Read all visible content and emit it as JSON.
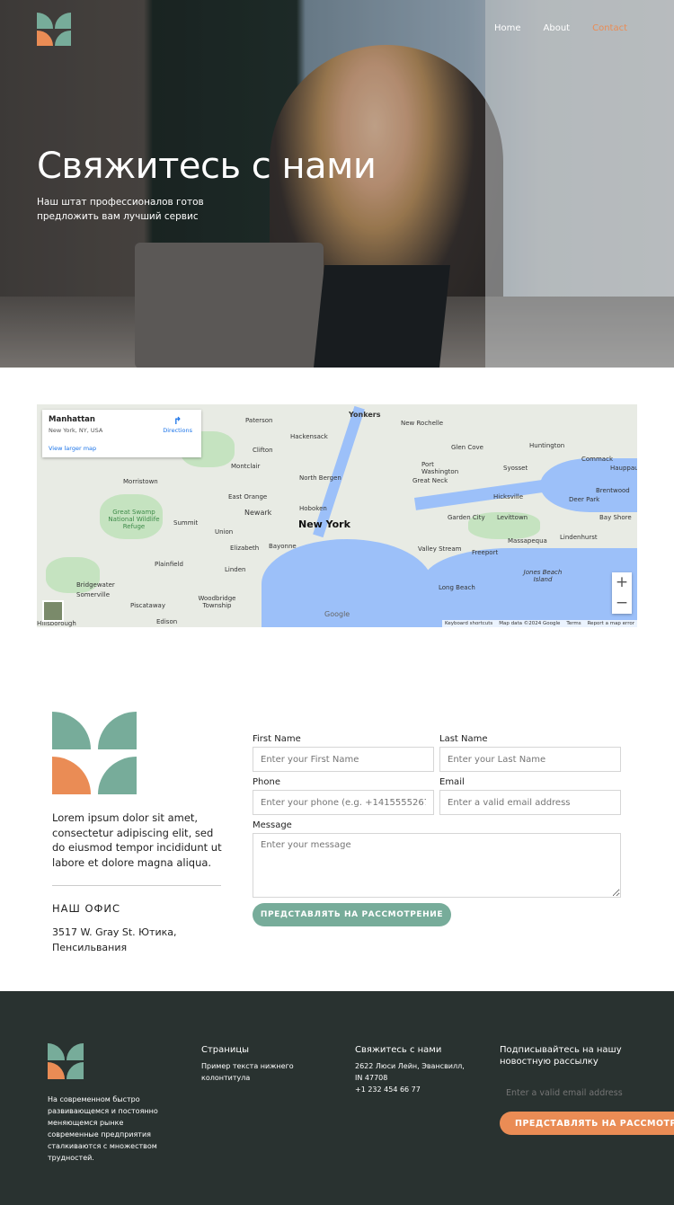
{
  "nav": {
    "items": [
      {
        "label": "Home"
      },
      {
        "label": "About"
      },
      {
        "label": "Contact",
        "active": true
      }
    ]
  },
  "hero": {
    "title": "Свяжитесь с нами",
    "subtitle": "Наш штат профессионалов готов предложить вам лучший сервис"
  },
  "map": {
    "place_title": "Manhattan",
    "place_address": "New York, NY, USA",
    "directions_label": "Directions",
    "view_larger": "View larger map",
    "zoom_in": "+",
    "zoom_out": "−",
    "google": "Google",
    "attribution": [
      "Keyboard shortcuts",
      "Map data ©2024 Google",
      "Terms",
      "Report a map error"
    ],
    "labels": [
      "Yonkers",
      "Paterson",
      "New Rochelle",
      "Hackensack",
      "Clifton",
      "Montclair",
      "North Bergen",
      "Glen Cove",
      "Huntington",
      "Commack",
      "Port Washington",
      "Syosset",
      "Great Neck",
      "Hicksville",
      "Deer Park",
      "Morristown",
      "East Orange",
      "Hoboken",
      "Newark",
      "New York",
      "Garden City",
      "Levittown",
      "Bay Shore",
      "Great Swamp National Wildlife Refuge",
      "Summit",
      "Union",
      "Elizabeth",
      "Bayonne",
      "Valley Stream",
      "Freeport",
      "Massapequa",
      "Lindenhurst",
      "Plainfield",
      "Linden",
      "Jones Beach Island",
      "Bridgewater",
      "Somerville",
      "Piscataway",
      "Woodbridge Township",
      "Long Beach",
      "Edison",
      "Hillsborough",
      "Brentwood",
      "Hauppauge"
    ]
  },
  "about": {
    "text": "Lorem ipsum dolor sit amet, consectetur adipiscing elit, sed do eiusmod tempor incididunt ut labore et dolore magna aliqua.",
    "office_heading": "НАШ ОФИС",
    "office_address": "3517 W. Gray St. Ютика, Пенсильвания"
  },
  "form": {
    "first_name": {
      "label": "First Name",
      "placeholder": "Enter your First Name"
    },
    "last_name": {
      "label": "Last Name",
      "placeholder": "Enter your Last Name"
    },
    "phone": {
      "label": "Phone",
      "placeholder": "Enter your phone (e.g. +14155552675)"
    },
    "email": {
      "label": "Email",
      "placeholder": "Enter a valid email address"
    },
    "message": {
      "label": "Message",
      "placeholder": "Enter your message"
    },
    "submit_label": "ПРЕДСТАВЛЯТЬ НА РАССМОТРЕНИЕ"
  },
  "footer": {
    "about": "На современном быстро развивающемся и постоянно меняющемся рынке современные предприятия сталкиваются с множеством трудностей.",
    "pages_heading": "Страницы",
    "pages_text": "Пример текста нижнего колонтитула",
    "contact_heading": "Свяжитесь с нами",
    "contact_address": "2622 Люси Лейн, Эвансвилл, IN 47708",
    "contact_phone": "+1 232 454 66 77",
    "newsletter_heading": "Подписывайтесь на нашу новостную рассылку",
    "newsletter_placeholder": "Enter a valid email address",
    "newsletter_submit": "ПРЕДСТАВЛЯТЬ НА РАССМОТРЕНИЕ"
  },
  "colors": {
    "accent_green": "#77ac9a",
    "accent_orange": "#ea8c55",
    "footer_bg": "#293230"
  }
}
